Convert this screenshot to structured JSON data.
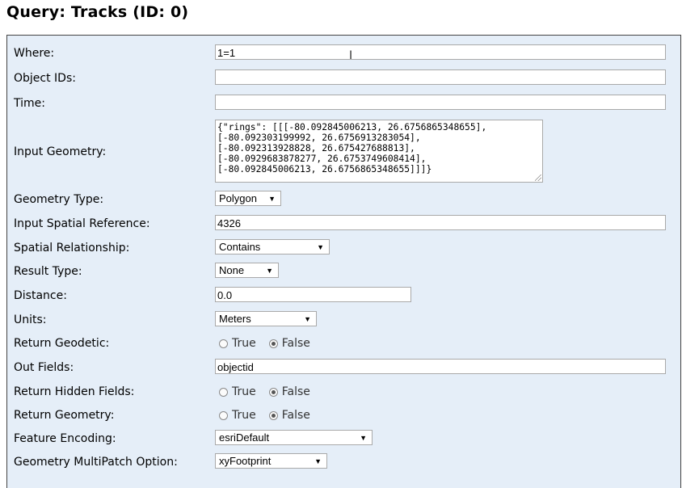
{
  "page": {
    "title": "Query: Tracks (ID: 0)"
  },
  "form": {
    "where": {
      "label": "Where:",
      "value": "1=1"
    },
    "object_ids": {
      "label": "Object IDs:",
      "value": ""
    },
    "time": {
      "label": "Time:",
      "value": ""
    },
    "input_geometry": {
      "label": "Input Geometry:",
      "value": "{\"rings\": [[[-80.092845006213, 26.6756865348655],\n[-80.092303199992, 26.6756913283054],\n[-80.092313928828, 26.675427688813],\n[-80.0929683878277, 26.6753749608414],\n[-80.092845006213, 26.6756865348655]]]}"
    },
    "geometry_type": {
      "label": "Geometry Type:",
      "selected": "Polygon"
    },
    "input_sr": {
      "label": "Input Spatial Reference:",
      "value": "4326"
    },
    "spatial_rel": {
      "label": "Spatial Relationship:",
      "selected": "Contains"
    },
    "result_type": {
      "label": "Result Type:",
      "selected": "None"
    },
    "distance": {
      "label": "Distance:",
      "value": "0.0"
    },
    "units": {
      "label": "Units:",
      "selected": "Meters"
    },
    "return_geodetic": {
      "label": "Return Geodetic:",
      "opt_true": "True",
      "opt_false": "False",
      "selected": "False"
    },
    "out_fields": {
      "label": "Out Fields:",
      "value": "objectid"
    },
    "return_hidden_fields": {
      "label": "Return Hidden Fields:",
      "opt_true": "True",
      "opt_false": "False",
      "selected": "False"
    },
    "return_geometry": {
      "label": "Return Geometry:",
      "opt_true": "True",
      "opt_false": "False",
      "selected": "False"
    },
    "feature_encoding": {
      "label": "Feature Encoding:",
      "selected": "esriDefault"
    },
    "multipatch_option": {
      "label": "Geometry MultiPatch Option:",
      "selected": "xyFootprint"
    }
  },
  "icons": {
    "dropdown_arrow": "▼",
    "text_cursor": "I"
  }
}
